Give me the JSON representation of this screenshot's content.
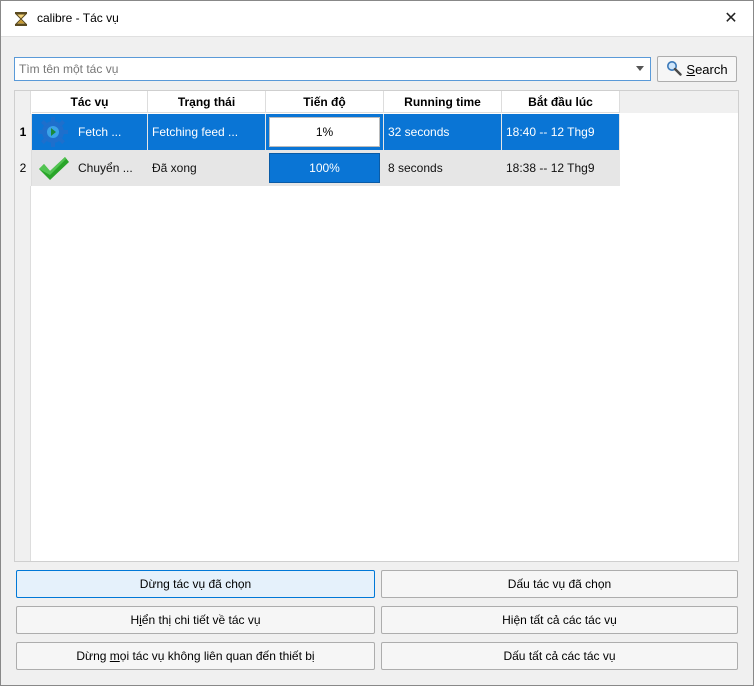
{
  "window": {
    "title": "calibre - Tác vụ",
    "close_label": "✕"
  },
  "search": {
    "placeholder": "Tìm tên một tác vụ",
    "button_label": "Search",
    "button_underline": "S",
    "button_rest": "earch"
  },
  "table": {
    "headers": [
      "Tác vụ",
      "Trạng thái",
      "Tiến độ",
      "Running time",
      "Bắt đầu lúc"
    ],
    "rows": [
      {
        "num": "1",
        "name": "Fetch ...",
        "icon": "gear-icon",
        "status": "Fetching feed ...",
        "progress_label": "1%",
        "progress": 0.01,
        "running_time": "32 seconds",
        "started": "18:40 -- 12 Thg9",
        "selected": true
      },
      {
        "num": "2",
        "name": "Chuyển ...",
        "icon": "checkmark-icon",
        "status": "Đã xong",
        "progress_label": "100%",
        "progress": 1.0,
        "running_time": "8 seconds",
        "started": "18:38 -- 12 Thg9",
        "selected": false
      }
    ]
  },
  "buttons": {
    "stop_selected": "Dừng tác vụ đã chọn",
    "hide_selected": "Dấu tác vụ đã chọn",
    "show_details_pre": "H",
    "show_details_u": "i",
    "show_details_post": "ển thị chi tiết về tác vụ",
    "show_all": "Hiện tất cả các tác vụ",
    "stop_all_pre": "Dừng ",
    "stop_all_u": "m",
    "stop_all_post": "ọi tác vụ không liên quan đến thiết bị",
    "hide_all": "Dấu tất cả các tác vụ"
  },
  "colors": {
    "selection": "#0a75d5",
    "accent": "#0078d7",
    "check": "#2aa52a"
  }
}
